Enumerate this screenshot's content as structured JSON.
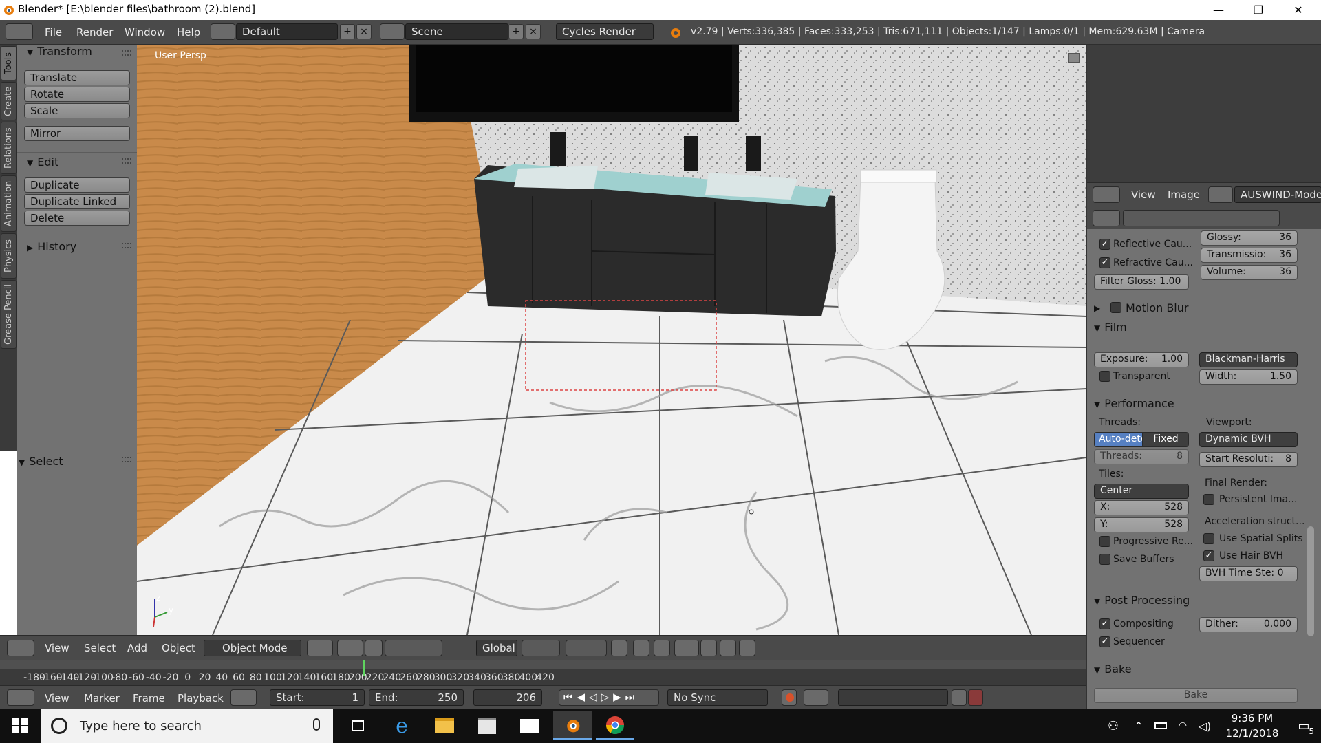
{
  "title": "Blender* [E:\\blender files\\bathroom (2).blend]",
  "window_controls": {
    "minimize": "—",
    "maximize": "❐",
    "close": "✕"
  },
  "menu": {
    "file": "File",
    "render": "Render",
    "window": "Window",
    "help": "Help"
  },
  "layout": "Default",
  "scene": "Scene",
  "engine": "Cycles Render",
  "stats": "v2.79 | Verts:336,385 | Faces:333,253 | Tris:671,111 | Objects:1/147 | Lamps:0/1 | Mem:629.63M | Camera",
  "left_tabs": [
    "Tools",
    "Create",
    "Relations",
    "Animation",
    "Physics",
    "Grease Pencil"
  ],
  "toolshelf": {
    "transform": {
      "title": "Transform",
      "buttons": [
        "Translate",
        "Rotate",
        "Scale",
        "Mirror"
      ]
    },
    "edit": {
      "title": "Edit",
      "buttons": [
        "Duplicate",
        "Duplicate Linked",
        "Delete"
      ]
    },
    "history": "History",
    "select": "Select"
  },
  "viewport": {
    "label": "User Persp",
    "axis_z": "z",
    "axis_y": "y"
  },
  "viewport_header": {
    "view": "View",
    "select": "Select",
    "add": "Add",
    "object": "Object",
    "mode": "Object Mode",
    "orientation": "Global"
  },
  "timeline": {
    "ticks": [
      "-180",
      "-160",
      "-140",
      "-120",
      "-100",
      "-80",
      "-60",
      "-40",
      "-20",
      "0",
      "20",
      "40",
      "60",
      "80",
      "100",
      "120",
      "140",
      "160",
      "180",
      "200",
      "220",
      "240",
      "260",
      "280",
      "300",
      "320",
      "340",
      "360",
      "380",
      "400",
      "420"
    ],
    "current_frame": 206
  },
  "timeline_header": {
    "view": "View",
    "marker": "Marker",
    "frame": "Frame",
    "playback": "Playback",
    "start_label": "Start:",
    "start": "1",
    "end_label": "End:",
    "end": "250",
    "current": "206",
    "sync": "No Sync"
  },
  "image_header": {
    "view": "View",
    "image": "Image",
    "name": "AUSWIND-Modern"
  },
  "properties": {
    "reflective": "Reflective Cau...",
    "refractive": "Refractive Cau...",
    "filter_gloss": "Filter Gloss: 1.00",
    "glossy_label": "Glossy:",
    "glossy": "36",
    "transmission_label": "Transmissio:",
    "transmission": "36",
    "volume_label": "Volume:",
    "volume": "36",
    "motion_blur": "Motion Blur",
    "film": "Film",
    "exposure_label": "Exposure:",
    "exposure": "1.00",
    "filter": "Blackman-Harris",
    "transparent": "Transparent",
    "width_label": "Width:",
    "width": "1.50",
    "performance": "Performance",
    "threads_label": "Threads:",
    "auto_detect": "Auto-dete",
    "fixed": "Fixed",
    "threads_field_label": "Threads:",
    "threads_field": "8",
    "viewport_label": "Viewport:",
    "bvh": "Dynamic BVH",
    "start_res_label": "Start Resoluti:",
    "start_res": "8",
    "tiles_label": "Tiles:",
    "tile_order": "Center",
    "x_label": "X:",
    "x": "528",
    "y_label": "Y:",
    "y": "528",
    "final_render": "Final Render:",
    "persistent": "Persistent Ima...",
    "accel": "Acceleration struct...",
    "spatial": "Use Spatial Splits",
    "hair": "Use Hair BVH",
    "bvh_time": "BVH Time Ste: 0",
    "progressive": "Progressive Re...",
    "save_buffers": "Save Buffers",
    "post": "Post Processing",
    "compositing": "Compositing",
    "dither_label": "Dither:",
    "dither": "0.000",
    "sequencer": "Sequencer",
    "bake": "Bake",
    "bake_btn": "Bake"
  },
  "taskbar": {
    "search": "Type here to search",
    "time": "9:36 PM",
    "date": "12/1/2018",
    "notif": "5"
  },
  "colors": {
    "blender_orange": "#e87d0d",
    "active_blue": "#5680c2",
    "taskbar": "#101010"
  }
}
